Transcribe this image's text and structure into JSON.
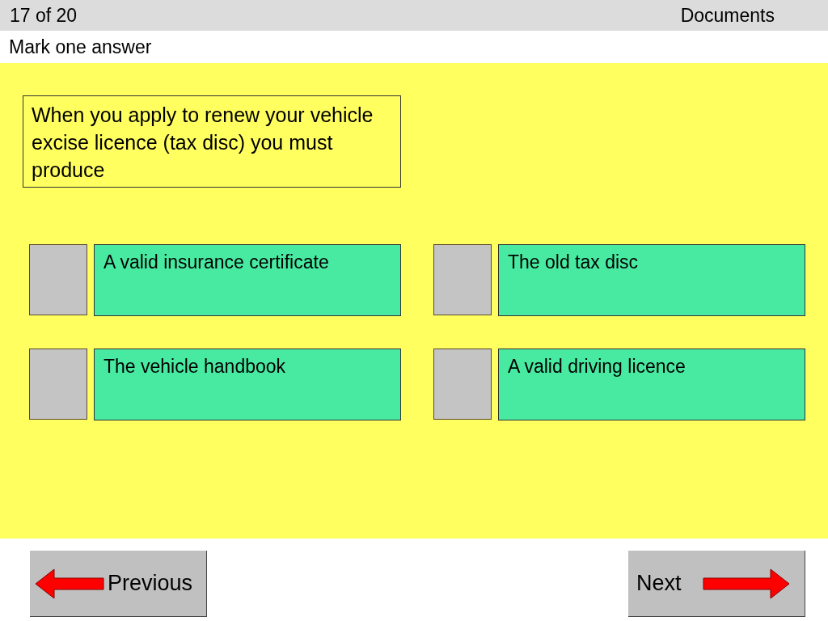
{
  "header": {
    "progress": "17 of 20",
    "topic": "Documents"
  },
  "instruction": "Mark one answer",
  "question": "When you apply to renew your vehicle excise licence (tax disc) you must produce",
  "answers": [
    {
      "text": "A valid insurance certificate",
      "checked": false
    },
    {
      "text": "The old tax disc",
      "checked": false
    },
    {
      "text": "The vehicle handbook",
      "checked": false
    },
    {
      "text": "A valid driving licence",
      "checked": false
    }
  ],
  "nav": {
    "previous": "Previous",
    "next": "Next"
  }
}
